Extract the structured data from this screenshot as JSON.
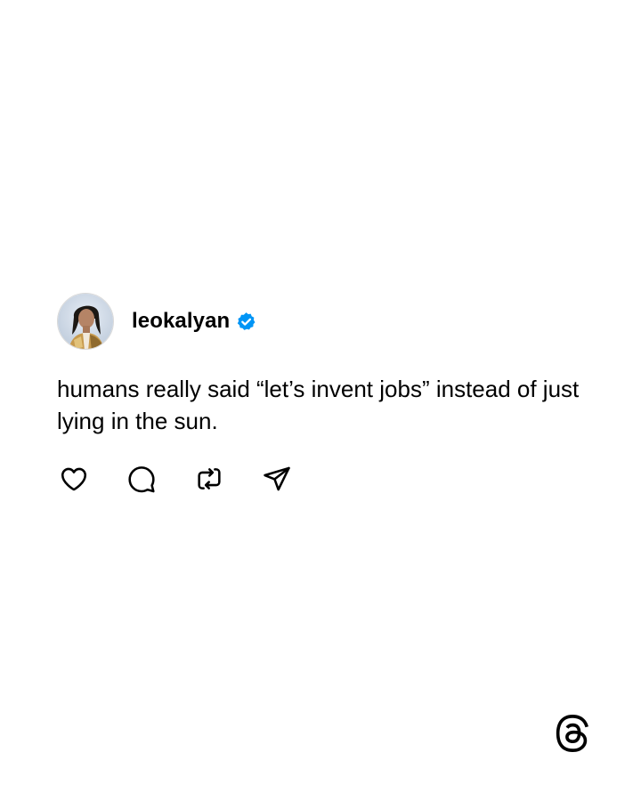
{
  "post": {
    "username": "leokalyan",
    "verified": true,
    "text": "humans really said “let’s invent jobs” instead of just lying in the sun."
  },
  "actions": [
    {
      "name": "like",
      "icon": "heart-icon"
    },
    {
      "name": "reply",
      "icon": "comment-icon"
    },
    {
      "name": "repost",
      "icon": "repost-icon"
    },
    {
      "name": "share",
      "icon": "send-icon"
    }
  ],
  "branding": {
    "logo": "threads-logo-icon"
  },
  "colors": {
    "background": "#ffffff",
    "text": "#000000",
    "verified_badge": "#0095f6"
  }
}
